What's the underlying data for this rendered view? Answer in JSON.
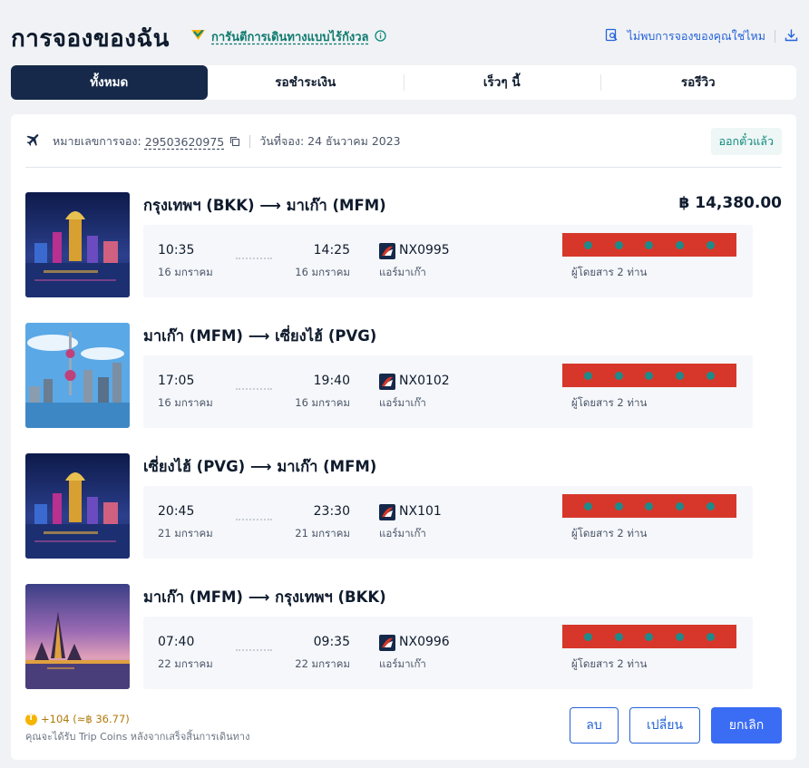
{
  "header": {
    "title": "การจองของฉัน",
    "guarantee_link": "การันตีการเดินทางแบบไร้กังวล",
    "missing_booking_link": "ไม่พบการจองของคุณใช่ไหม"
  },
  "tabs": [
    {
      "label": "ทั้งหมด",
      "active": true
    },
    {
      "label": "รอชำระเงิน",
      "active": false
    },
    {
      "label": "เร็วๆ นี้",
      "active": false
    },
    {
      "label": "รอรีวิว",
      "active": false
    }
  ],
  "booking": {
    "booking_no_label": "หมายเลขการจอง:",
    "booking_no": "29503620975",
    "booking_date": "วันที่จอง: 24 ธันวาคม 2023",
    "status": "ออกตั๋วแล้ว",
    "price": "฿ 14,380.00"
  },
  "segments": [
    {
      "route_from": "กรุงเทพฯ (BKK)",
      "route_to": "มาเก๊า (MFM)",
      "dep_time": "10:35",
      "dep_date": "16 มกราคม",
      "arr_time": "14:25",
      "arr_date": "16 มกราคม",
      "flight_no": "NX0995",
      "airline": "แอร์มาเก๊า",
      "passengers": "ผู้โดยสาร 2 ท่าน"
    },
    {
      "route_from": "มาเก๊า (MFM)",
      "route_to": "เซี่ยงไฮ้ (PVG)",
      "dep_time": "17:05",
      "dep_date": "16 มกราคม",
      "arr_time": "19:40",
      "arr_date": "16 มกราคม",
      "flight_no": "NX0102",
      "airline": "แอร์มาเก๊า",
      "passengers": "ผู้โดยสาร 2 ท่าน"
    },
    {
      "route_from": "เซี่ยงไฮ้ (PVG)",
      "route_to": "มาเก๊า (MFM)",
      "dep_time": "20:45",
      "dep_date": "21 มกราคม",
      "arr_time": "23:30",
      "arr_date": "21 มกราคม",
      "flight_no": "NX101",
      "airline": "แอร์มาเก๊า",
      "passengers": "ผู้โดยสาร 2 ท่าน"
    },
    {
      "route_from": "มาเก๊า (MFM)",
      "route_to": "กรุงเทพฯ (BKK)",
      "dep_time": "07:40",
      "dep_date": "22 มกราคม",
      "arr_time": "09:35",
      "arr_date": "22 มกราคม",
      "flight_no": "NX0996",
      "airline": "แอร์มาเก๊า",
      "passengers": "ผู้โดยสาร 2 ท่าน"
    }
  ],
  "route_arrow": "⟶",
  "footer": {
    "coins": "+104 (≈฿ 36.77)",
    "coins_note": "คุณจะได้รับ Trip Coins หลังจากเสร็จสิ้นการเดินทาง"
  },
  "buttons": {
    "delete": "ลบ",
    "change": "เปลี่ยน",
    "cancel": "ยกเลิก"
  },
  "colors": {
    "navy": "#16294a",
    "accent_blue": "#3a6cf4",
    "teal": "#0e8a7c",
    "redaction": "#d6372a"
  },
  "icons": [
    "shield-check-icon",
    "info-circle-icon",
    "search-document-icon",
    "download-icon",
    "airplane-icon",
    "copy-icon",
    "airline-logo-icon",
    "coin-icon"
  ]
}
